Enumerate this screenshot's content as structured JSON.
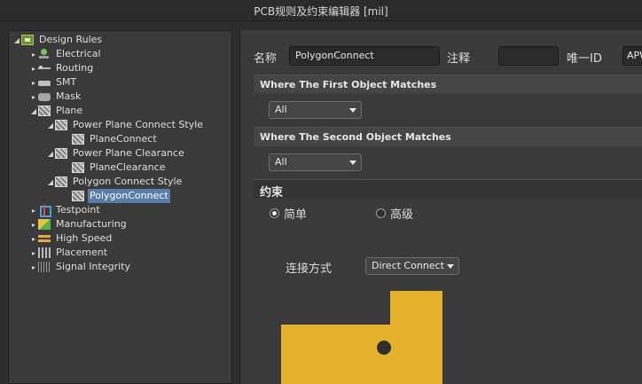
{
  "window": {
    "title": "PCB规则及约束编辑器 [mil]"
  },
  "tree": {
    "items": [
      {
        "label": "Design Rules",
        "icon": "design-rules-icon",
        "arrow": "◢",
        "level": 0
      },
      {
        "label": "Electrical",
        "icon": "electrical-icon",
        "arrow": "▸",
        "level": 1
      },
      {
        "label": "Routing",
        "icon": "routing-icon",
        "arrow": "▸",
        "level": 1
      },
      {
        "label": "SMT",
        "icon": "smt-icon",
        "arrow": "▸",
        "level": 1
      },
      {
        "label": "Mask",
        "icon": "mask-icon",
        "arrow": "▸",
        "level": 1
      },
      {
        "label": "Plane",
        "icon": "plane-icon",
        "arrow": "◢",
        "level": 1
      },
      {
        "label": "Power Plane Connect Style",
        "icon": "plane-rule-icon",
        "arrow": "◢",
        "level": 2
      },
      {
        "label": "PlaneConnect",
        "icon": "plane-rule-icon",
        "arrow": "",
        "level": 3
      },
      {
        "label": "Power Plane Clearance",
        "icon": "plane-rule-icon",
        "arrow": "◢",
        "level": 2
      },
      {
        "label": "PlaneClearance",
        "icon": "plane-rule-icon",
        "arrow": "",
        "level": 3
      },
      {
        "label": "Polygon Connect Style",
        "icon": "plane-rule-icon",
        "arrow": "◢",
        "level": 2
      },
      {
        "label": "PolygonConnect",
        "icon": "plane-rule-icon",
        "arrow": "",
        "level": 3,
        "selected": true
      },
      {
        "label": "Testpoint",
        "icon": "testpoint-icon",
        "arrow": "▸",
        "level": 1
      },
      {
        "label": "Manufacturing",
        "icon": "manufacturing-icon",
        "arrow": "▸",
        "level": 1
      },
      {
        "label": "High Speed",
        "icon": "high-speed-icon",
        "arrow": "▸",
        "level": 1
      },
      {
        "label": "Placement",
        "icon": "placement-icon",
        "arrow": "▸",
        "level": 1
      },
      {
        "label": "Signal Integrity",
        "icon": "signal-integrity-icon",
        "arrow": "▸",
        "level": 1
      }
    ]
  },
  "rule": {
    "name_label": "名称",
    "name_value": "PolygonConnect",
    "comment_label": "注释",
    "comment_value": "",
    "uid_label": "唯一ID",
    "uid_value": "APW"
  },
  "first_match": {
    "header": "Where The First Object Matches",
    "value": "All"
  },
  "second_match": {
    "header": "Where The Second Object Matches",
    "value": "All"
  },
  "constraints": {
    "header": "约束",
    "simple_label": "简单",
    "advanced_label": "高级",
    "mode_selected": "simple",
    "connect_label": "连接方式",
    "connect_value": "Direct Connect"
  },
  "colors": {
    "accent_selection": "#5a7ca8",
    "copper": "#e2b32a",
    "via_hole": "#2f2f2f"
  }
}
